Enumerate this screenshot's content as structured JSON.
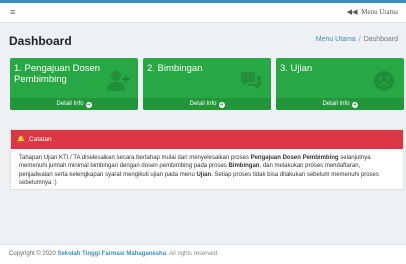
{
  "navbar": {
    "hamburger_icon": "≡",
    "menu_arrow_icon": "◀◀",
    "menu_label": "Menu Utama"
  },
  "page": {
    "title": "Dashboard"
  },
  "breadcrumb": {
    "link": "Menu Utama",
    "separator": "/",
    "current": "Dashboard"
  },
  "cards": [
    {
      "title_line1": "1. Pengajuan Dosen",
      "title_line2": "Pembimbing",
      "footer": "Detail Info",
      "icon": "user-plus-icon",
      "color": "#28a745"
    },
    {
      "title_line1": "2. Bimbingan",
      "title_line2": "",
      "footer": "Detail Info",
      "icon": "comments-icon",
      "color": "#28a745"
    },
    {
      "title_line1": "3. Ujian",
      "title_line2": "",
      "footer": "Detail Info",
      "icon": "frown-icon",
      "color": "#28a745"
    }
  ],
  "alert": {
    "title": "Catatan",
    "icon": "bell-icon",
    "color": "#dc3545",
    "text_1": "Tahapan Ujian KTI / TA diselesaikan secara bertahap mulai dari menyelesaikan proses ",
    "bold_1": "Pengajuan Dosen Pembimbing",
    "text_2": " selanjutnya memenuhi jumlah minimal bimbingan dengan dosen pembimbing pada proses ",
    "bold_2": "Bimbingan",
    "text_3": ", dan melakukan proses mendaftaran, penjadwalan serta kelengkapan syarat mengikuti ujian pada menu ",
    "bold_3": "Ujian",
    "text_4": ". Setiap proses tidak bisa dilakukan sebelum memenuhi proses sebelumnya :)"
  },
  "footer": {
    "prefix": "Copyright © 2020 ",
    "school": "Sekolah Tinggi Farmasi Mahaganesha",
    "suffix": ". All rights reserved."
  },
  "colors": {
    "accent": "#3c8dbc",
    "card_green": "#28a745",
    "alert_red": "#dc3545"
  }
}
